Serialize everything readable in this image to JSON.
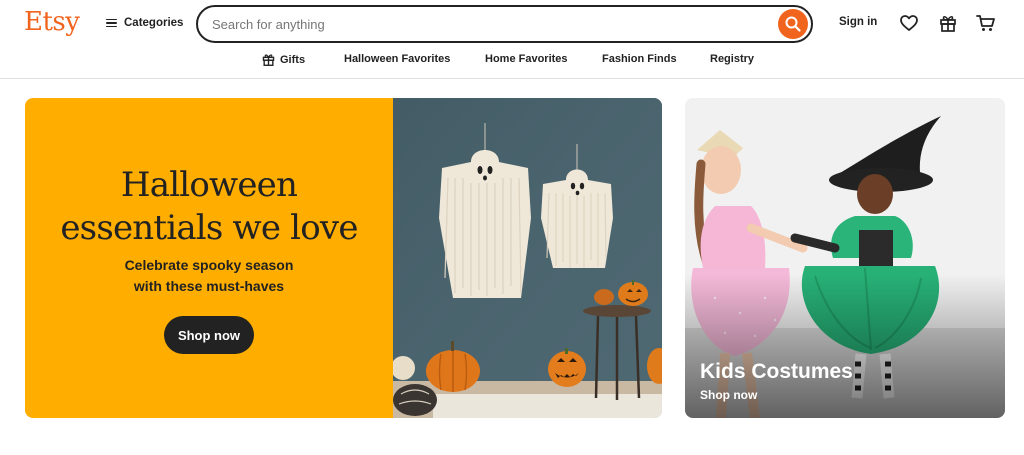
{
  "brand": {
    "logo_text": "Etsy",
    "accent": "#F1641E"
  },
  "header": {
    "categories_label": "Categories",
    "search": {
      "placeholder": "Search for anything",
      "value": ""
    },
    "sign_in_label": "Sign in",
    "icons": [
      "heart-icon",
      "gift-icon",
      "cart-icon"
    ]
  },
  "subnav": {
    "items": [
      {
        "label": "Gifts",
        "icon": "gift-icon"
      },
      {
        "label": "Halloween Favorites"
      },
      {
        "label": "Home Favorites"
      },
      {
        "label": "Fashion Finds"
      },
      {
        "label": "Registry"
      }
    ]
  },
  "hero": {
    "title_line1": "Halloween",
    "title_line2": "essentials we love",
    "subtitle_line1": "Celebrate spooky season",
    "subtitle_line2": "with these must-haves",
    "button_label": "Shop now",
    "background": "#FFAE00"
  },
  "promo": {
    "title": "Kids Costumes",
    "link_label": "Shop now"
  }
}
